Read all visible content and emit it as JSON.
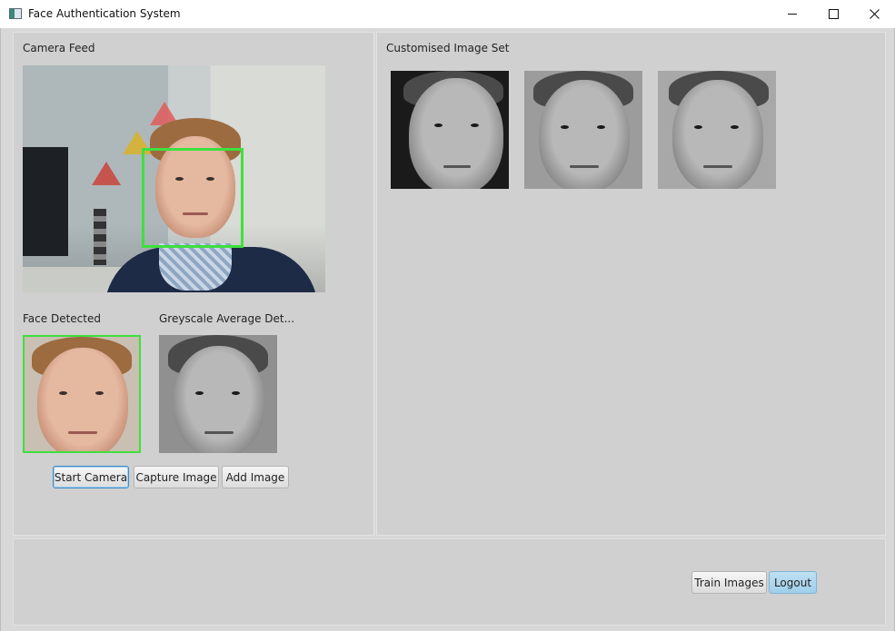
{
  "window": {
    "title": "Face Authentication System",
    "controls": {
      "minimize_icon": "minimize-icon",
      "maximize_icon": "maximize-icon",
      "close_icon": "close-icon"
    }
  },
  "left_panel": {
    "camera_feed_label": "Camera Feed",
    "face_detected_label": "Face Detected",
    "greyscale_label": "Greyscale Average Det...",
    "buttons": {
      "start_camera": "Start Camera",
      "capture_image": "Capture Image",
      "add_image": "Add Image"
    }
  },
  "right_panel": {
    "customised_set_label": "Customised Image Set",
    "image_count": 3
  },
  "bottom_panel": {
    "buttons": {
      "train_images": "Train Images",
      "logout": "Logout"
    }
  },
  "colors": {
    "face_detection_box": "#3ee03e",
    "primary_button": "#a8d3ec",
    "panel_background": "#d0d0d0"
  }
}
